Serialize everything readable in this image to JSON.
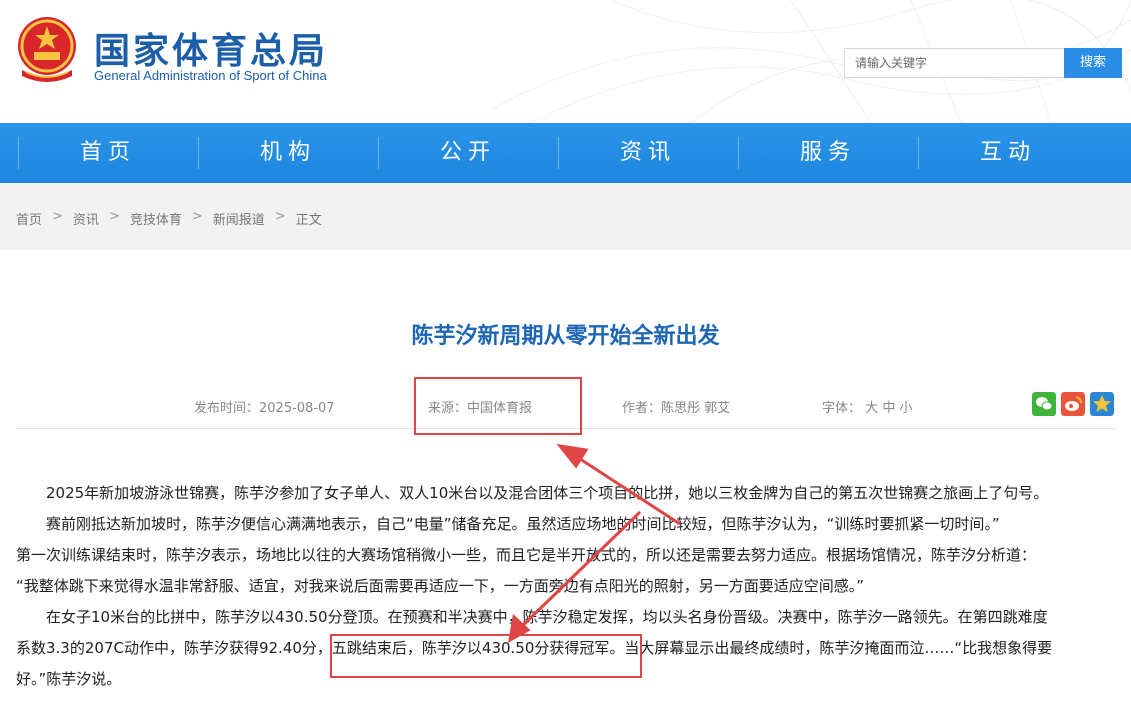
{
  "header": {
    "title": "国家体育总局",
    "subtitle": "General Administration of Sport of China",
    "search_placeholder": "请输入关键字",
    "search_button": "搜索"
  },
  "nav": [
    "首页",
    "机构",
    "公开",
    "资讯",
    "服务",
    "互动"
  ],
  "breadcrumb": [
    "首页",
    "资讯",
    "竞技体育",
    "新闻报道",
    "正文"
  ],
  "breadcrumb_sep": ">",
  "article": {
    "title": "陈芋汐新周期从零开始全新出发",
    "publish": "发布时间：2025-08-07",
    "source": "来源：中国体育报",
    "author": "作者：陈思彤 郭艾",
    "font_label": "字体：",
    "font_sizes": [
      "大",
      "中",
      "小"
    ],
    "p1": "2025年新加坡游泳世锦赛，陈芋汐参加了女子单人、双人10米台以及混合团体三个项目的比拼，她以三枚金牌为自己的第五次世锦赛之旅画上了句号。",
    "p2_line1": "赛前刚抵达新加坡时，陈芋汐便信心满满地表示，自己“电量”储备充足。虽然适应场地的时间比较短，但陈芋汐认为，“训练时要抓紧一切时间。”",
    "p2_line2": "第一次训练课结束时，陈芋汐表示，场地比以往的大赛场馆稍微小一些，而且它是半开放式的，所以还是需要去努力适应。根据场馆情况，陈芋汐分析道：",
    "p2_line3": "“我整体跳下来觉得水温非常舒服、适宜，对我来说后面需要再适应一下，一方面旁边有点阳光的照射，另一方面要适应空间感。”",
    "p3_line1": "在女子10米台的比拼中，陈芋汐以430.50分登顶。在预赛和半决赛中，陈芋汐稳定发挥，均以头名身份晋级。决赛中，陈芋汐一路领先。在第四跳难度",
    "p3_line2a": "系数3.3的207C动作中，陈芋汐获得92.40分，",
    "p3_line2b": "五跳结束后，陈芋汐以430.50分获得冠军。",
    "p3_line2c": "当大屏幕显示出最终成绩时，陈芋汐掩面而泣……“比我想象得要",
    "p3_line3": "好。”陈芋汐说。"
  },
  "share_icons": [
    "wechat-icon",
    "weibo-icon",
    "favorite-star-icon"
  ],
  "colors": {
    "nav_blue": "#2a8ee8",
    "title_blue": "#1d66b5",
    "highlight_red": "#e04545"
  }
}
